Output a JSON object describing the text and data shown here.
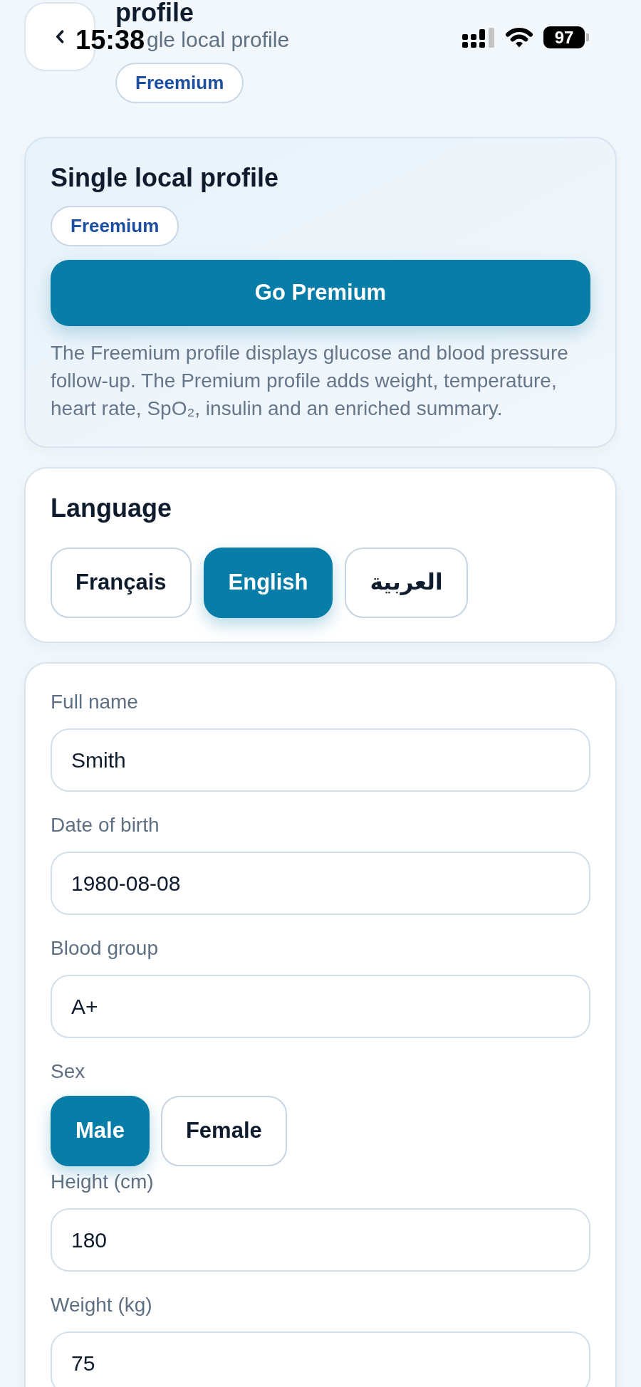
{
  "status_bar": {
    "time": "15:38",
    "battery": "97"
  },
  "header": {
    "title": "profile",
    "subtitle": "gle local profile",
    "badge": "Freemium"
  },
  "plan_card": {
    "title": "Single local profile",
    "badge": "Freemium",
    "button": "Go Premium",
    "description": "The Freemium profile displays glucose and blood pressure follow-up. The Premium profile adds weight, temperature, heart rate, SpO₂, insulin and an enriched summary."
  },
  "language_card": {
    "title": "Language",
    "options": [
      {
        "label": "Français",
        "selected": false
      },
      {
        "label": "English",
        "selected": true
      },
      {
        "label": "العربية",
        "selected": false
      }
    ]
  },
  "profile_form": {
    "fields": [
      {
        "kind": "text",
        "label": "Full name",
        "value": "Smith"
      },
      {
        "kind": "text",
        "label": "Date of birth",
        "value": "1980-08-08"
      },
      {
        "kind": "text",
        "label": "Blood group",
        "value": "A+"
      },
      {
        "kind": "choice",
        "label": "Sex",
        "options": [
          {
            "label": "Male",
            "selected": true
          },
          {
            "label": "Female",
            "selected": false
          }
        ]
      },
      {
        "kind": "text",
        "label": "Height (cm)",
        "value": "180"
      },
      {
        "kind": "text",
        "label": "Weight (kg)",
        "value": "75"
      }
    ]
  }
}
